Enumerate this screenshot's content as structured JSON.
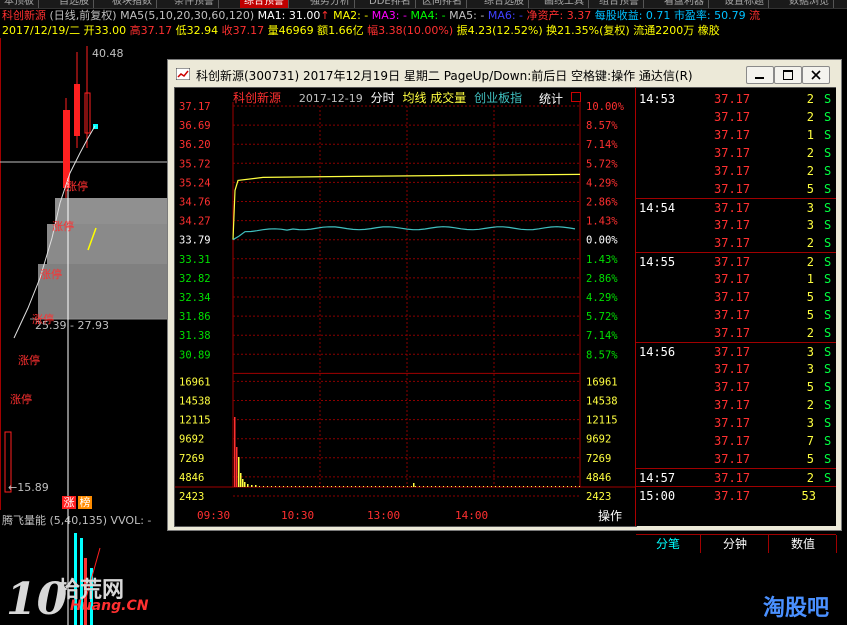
{
  "tabs": [
    "本顶板",
    "自选股",
    "板块指数",
    "条件预警",
    "综合预警",
    "强势分析",
    "DDE排名",
    "区间排名",
    "综合选股",
    "画线工具",
    "组合预警",
    "看盘利器",
    "设置标题",
    "数据浏览"
  ],
  "active_tab_index": 4,
  "kline_header": {
    "stock_name": "科创新源",
    "period": "(日线,前复权)",
    "ma_label": "MA5(5,10,20,30,60,120)",
    "ma1": "MA1: 31.00",
    "ma2": "MA2: -",
    "ma3": "MA3: -",
    "ma4": "MA4: -",
    "ma5": "MA5: -",
    "ma6": "MA6: -",
    "net_assets": "净资产: 3.37",
    "eps": "每股收益: 0.71",
    "pe": "市盈率: 50.79",
    "liutong": "流"
  },
  "day_info": {
    "date": "2017/12/19/二",
    "open": "开33.00",
    "high": "高37.17",
    "low": "低32.94",
    "close": "收37.17",
    "volume": "量46969",
    "amount": "额1.66亿",
    "change": "幅3.38(10.00%)",
    "amplitude": "振4.23(12.52%)",
    "turnover": "换21.35%(复权)",
    "float": "流通2200万",
    "sector": "橡胶"
  },
  "kline": {
    "high_label": "40.48",
    "range_label": "25.39 - 27.93",
    "low_label": "←15.89",
    "zt_labels": [
      "涨停",
      "涨停",
      "涨停",
      "涨停",
      "涨停",
      "涨停"
    ],
    "badge1": "涨",
    "badge2": "榜",
    "indicator_label": "腾飞量能 (5,40,135) VVOL: -"
  },
  "dialog": {
    "title": "科创新源(300731) 2017年12月19日 星期二 PageUp/Down:前后日 空格键:操作 通达信(R)",
    "chart_header": {
      "name": "科创新源",
      "date": "2017-12-19",
      "mode": "分时",
      "avg_label": "均线",
      "vol_label": "成交量",
      "index_label": "创业板指",
      "stats": "统计"
    },
    "price_labels": [
      "37.17",
      "36.69",
      "36.20",
      "35.72",
      "35.24",
      "34.76",
      "34.27",
      "33.79",
      "33.31",
      "32.82",
      "32.34",
      "31.86",
      "31.38",
      "30.89"
    ],
    "pct_labels": [
      "10.00%",
      "8.57%",
      "7.14%",
      "5.72%",
      "4.29%",
      "2.86%",
      "1.43%",
      "0.00%",
      "1.43%",
      "2.86%",
      "4.29%",
      "5.72%",
      "7.14%",
      "8.57%"
    ],
    "vol_labels": [
      "16961",
      "14538",
      "12115",
      "9692",
      "7269",
      "4846",
      "2423"
    ],
    "time_labels": [
      "09:30",
      "10:30",
      "13:00",
      "14:00"
    ],
    "operate_label": "操作",
    "ticks": [
      {
        "time": "14:53",
        "price": "37.17",
        "vol": "2",
        "bs": "S"
      },
      {
        "time": "",
        "price": "37.17",
        "vol": "2",
        "bs": "S"
      },
      {
        "time": "",
        "price": "37.17",
        "vol": "1",
        "bs": "S"
      },
      {
        "time": "",
        "price": "37.17",
        "vol": "2",
        "bs": "S"
      },
      {
        "time": "",
        "price": "37.17",
        "vol": "2",
        "bs": "S"
      },
      {
        "time": "",
        "price": "37.17",
        "vol": "5",
        "bs": "S"
      },
      {
        "time": "14:54",
        "price": "37.17",
        "vol": "3",
        "bs": "S"
      },
      {
        "time": "",
        "price": "37.17",
        "vol": "3",
        "bs": "S"
      },
      {
        "time": "",
        "price": "37.17",
        "vol": "2",
        "bs": "S"
      },
      {
        "time": "14:55",
        "price": "37.17",
        "vol": "2",
        "bs": "S"
      },
      {
        "time": "",
        "price": "37.17",
        "vol": "1",
        "bs": "S"
      },
      {
        "time": "",
        "price": "37.17",
        "vol": "5",
        "bs": "S"
      },
      {
        "time": "",
        "price": "37.17",
        "vol": "5",
        "bs": "S"
      },
      {
        "time": "",
        "price": "37.17",
        "vol": "2",
        "bs": "S"
      },
      {
        "time": "14:56",
        "price": "37.17",
        "vol": "3",
        "bs": "S"
      },
      {
        "time": "",
        "price": "37.17",
        "vol": "3",
        "bs": "S"
      },
      {
        "time": "",
        "price": "37.17",
        "vol": "5",
        "bs": "S"
      },
      {
        "time": "",
        "price": "37.17",
        "vol": "2",
        "bs": "S"
      },
      {
        "time": "",
        "price": "37.17",
        "vol": "3",
        "bs": "S"
      },
      {
        "time": "",
        "price": "37.17",
        "vol": "7",
        "bs": "S"
      },
      {
        "time": "",
        "price": "37.17",
        "vol": "5",
        "bs": "S"
      },
      {
        "time": "14:57",
        "price": "37.17",
        "vol": "2",
        "bs": "S"
      },
      {
        "time": "15:00",
        "price": "37.17",
        "vol": "53",
        "bs": ""
      }
    ],
    "bottom_tabs": [
      "分笔",
      "分钟",
      "价位",
      "数值"
    ]
  },
  "watermark": {
    "left_number": "10",
    "left_cn": "拾荒网",
    "left_en": "Huang.CN",
    "right": "淘股吧"
  },
  "colors": {
    "up": "#ff3030",
    "down": "#00ffff",
    "price_line": "#ffff40",
    "avg_line": "#40c0c0",
    "grid": "#8b0000",
    "frame": "#a00000"
  }
}
